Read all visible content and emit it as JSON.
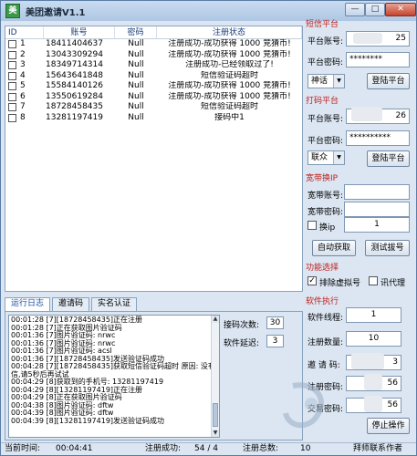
{
  "window": {
    "title": "美团邀请V1.1",
    "icon": "app-icon",
    "min": "—",
    "max": "□",
    "close": "✕"
  },
  "grid": {
    "headers": [
      "ID",
      "账号",
      "密码",
      "注册状态"
    ],
    "rows": [
      {
        "id": "1",
        "account": "18411404637",
        "password": "Null",
        "status": "注册成功-成功获得 1000 竞猜币!",
        "checked": false
      },
      {
        "id": "2",
        "account": "13043309294",
        "password": "Null",
        "status": "注册成功-成功获得 1000 竞猜币!",
        "checked": false
      },
      {
        "id": "3",
        "account": "18349714314",
        "password": "Null",
        "status": "注册成功-已经领取过了!",
        "checked": false
      },
      {
        "id": "4",
        "account": "15643641848",
        "password": "Null",
        "status": "短信验证码超时",
        "checked": false
      },
      {
        "id": "5",
        "account": "15584140126",
        "password": "Null",
        "status": "注册成功-成功获得 1000 竞猜币!",
        "checked": false
      },
      {
        "id": "6",
        "account": "13550619284",
        "password": "Null",
        "status": "注册成功-成功获得 1000 竞猜币!",
        "checked": false
      },
      {
        "id": "7",
        "account": "18728458435",
        "password": "Null",
        "status": "短信验证码超时",
        "checked": false
      },
      {
        "id": "8",
        "account": "13281197419",
        "password": "Null",
        "status": "接码中1",
        "checked": false
      }
    ]
  },
  "tabs": [
    "运行日志",
    "邀请码",
    "实名认证"
  ],
  "log": [
    "00:01:28 [7][18728458435]正在注册",
    "00:01:28 [7]正在获取图片验证码",
    "00:01:36 [7]图片验证码: nrwc",
    "00:01:36 [7]图片验证码: nrwc",
    "00:01:36 [7]图片验证码: acsl",
    "00:01:36 [7][18728458435]发送验证码成功",
    "00:04:28 [7][18728458435]获取短信验证码超时   原因: 没有状态或短",
    "信,请5秒后再试试",
    "00:04:29 [8]获取到的手机号: 13281197419",
    "00:04:29 [8][13281197419]正在注册",
    "00:04:29 [8]正在获取图片验证码",
    "00:04:38 [8]图片验证码: dftw",
    "00:04:39 [8]图片验证码: dftw",
    "00:04:39 [8][13281197419]发送验证码成功"
  ],
  "log_settings": {
    "count_label": "接码次数:",
    "count_value": "30",
    "delay_label": "软件延迟:",
    "delay_value": "3"
  },
  "platform_short": {
    "title": "短信平台",
    "account_label": "平台账号:",
    "account_value": "25",
    "password_label": "平台密码:",
    "password_value": "********",
    "select": "神话",
    "login": "登陆平台"
  },
  "platform_receive": {
    "title": "打码平台",
    "account_label": "平台账号:",
    "account_value": "26",
    "password_label": "平台密码:",
    "password_value": "**********",
    "select": "联众",
    "login": "登陆平台"
  },
  "broadband": {
    "title": "宽带换IP",
    "account_label": "宽带账号:",
    "password_label": "宽带密码:",
    "switch_label": "换ip",
    "switch_value": "1",
    "auto_button": "自动获取",
    "test_button": "测试拔号"
  },
  "features": {
    "title": "功能选择",
    "opt1": "排除虚拟号",
    "opt1_checked": true,
    "opt2": "讯代理",
    "opt2_checked": false
  },
  "software": {
    "title": "软件执行",
    "threads_label": "软件线程:",
    "threads_value": "1",
    "reg_count_label": "注册数量:",
    "reg_count_value": "10",
    "invite_label": "邀 请 码:",
    "invite_value": "3",
    "reg_password_label": "注册密码:",
    "reg_password_value": "56",
    "trade_password_label": "交易密码:",
    "trade_password_value": "56",
    "stop_button": "停止操作"
  },
  "status": {
    "time_label": "当前时间:",
    "time_value": "00:04:41",
    "success_label": "注册成功:",
    "success_value": "54 / 4",
    "total_label": "注册总数:",
    "total_value": "10",
    "author": "拜师联系作者"
  },
  "watermark": "当下软件园 www.downxia.com"
}
